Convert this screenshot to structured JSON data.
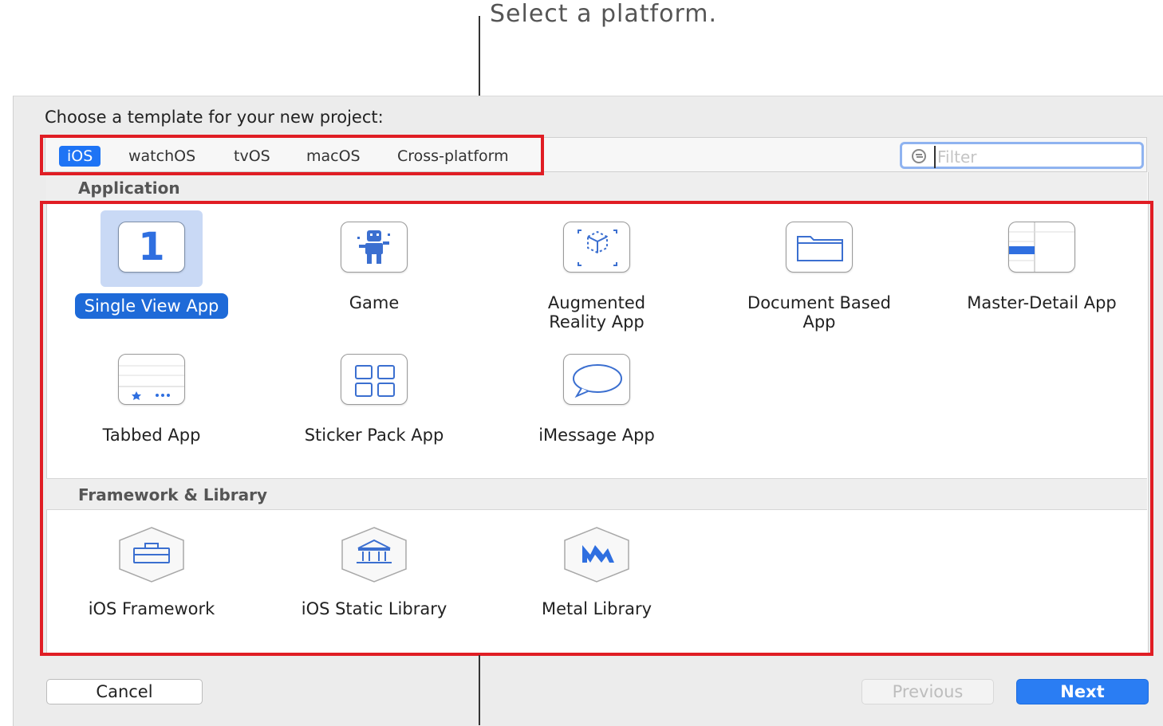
{
  "callout": {
    "top_text": "Select a platform."
  },
  "dialog": {
    "heading": "Choose a template for your new project:"
  },
  "platform_tabs": [
    {
      "label": "iOS",
      "active": true
    },
    {
      "label": "watchOS",
      "active": false
    },
    {
      "label": "tvOS",
      "active": false
    },
    {
      "label": "macOS",
      "active": false
    },
    {
      "label": "Cross-platform",
      "active": false
    }
  ],
  "filter": {
    "placeholder": "Filter",
    "value": ""
  },
  "sections": {
    "application": {
      "title": "Application",
      "items": [
        {
          "label": "Single View App",
          "icon": "single-view-icon",
          "selected": true
        },
        {
          "label": "Game",
          "icon": "game-icon",
          "selected": false
        },
        {
          "label": "Augmented Reality App",
          "icon": "augmented-reality-icon",
          "selected": false
        },
        {
          "label": "Document Based App",
          "icon": "document-folder-icon",
          "selected": false
        },
        {
          "label": "Master-Detail App",
          "icon": "master-detail-icon",
          "selected": false
        },
        {
          "label": "Tabbed App",
          "icon": "tabbed-app-icon",
          "selected": false
        },
        {
          "label": "Sticker Pack App",
          "icon": "sticker-grid-icon",
          "selected": false
        },
        {
          "label": "iMessage App",
          "icon": "speech-bubble-icon",
          "selected": false
        }
      ]
    },
    "framework": {
      "title": "Framework & Library",
      "items": [
        {
          "label": "iOS Framework",
          "icon": "toolbox-icon"
        },
        {
          "label": "iOS Static Library",
          "icon": "library-building-icon"
        },
        {
          "label": "Metal Library",
          "icon": "metal-icon"
        }
      ]
    }
  },
  "single_view_glyph": "1",
  "buttons": {
    "cancel": "Cancel",
    "previous": "Previous",
    "next": "Next"
  },
  "colors": {
    "accent": "#1e74f5",
    "highlight_box": "#e01d24",
    "selected_bg": "#c9d9f5"
  }
}
